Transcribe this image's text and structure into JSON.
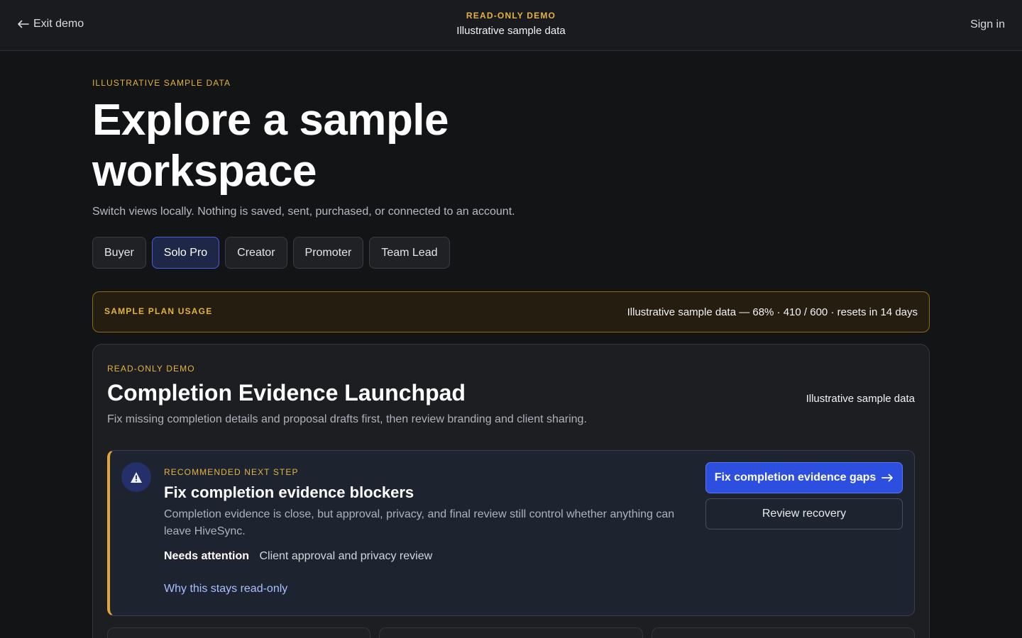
{
  "topbar": {
    "exit_label": "Exit demo",
    "eyebrow": "READ-ONLY DEMO",
    "subtitle": "Illustrative sample data",
    "signin_label": "Sign in"
  },
  "hero": {
    "eyebrow": "ILLUSTRATIVE SAMPLE DATA",
    "title": "Explore a sample workspace",
    "subtitle": "Switch views locally. Nothing is saved, sent, purchased, or connected to an account."
  },
  "tabs": [
    {
      "label": "Buyer",
      "active": false
    },
    {
      "label": "Solo Pro",
      "active": true
    },
    {
      "label": "Creator",
      "active": false
    },
    {
      "label": "Promoter",
      "active": false
    },
    {
      "label": "Team Lead",
      "active": false
    }
  ],
  "usage": {
    "label": "SAMPLE PLAN USAGE",
    "value": "Illustrative sample data — 68% · 410 / 600 · resets in 14 days"
  },
  "card": {
    "eyebrow": "READ-ONLY DEMO",
    "title": "Completion Evidence Launchpad",
    "description": "Fix missing completion details and proposal drafts first, then review branding and client sharing.",
    "right_label": "Illustrative sample data"
  },
  "recommendation": {
    "eyebrow": "RECOMMENDED NEXT STEP",
    "title": "Fix completion evidence blockers",
    "description": "Completion evidence is close, but approval, privacy, and final review still control whether anything can leave HiveSync.",
    "attention_label": "Needs attention",
    "attention_value": "Client approval and privacy review",
    "link_label": "Why this stays read-only",
    "primary_button": "Fix completion evidence gaps",
    "secondary_button": "Review recovery",
    "icon": "alert-triangle-icon"
  },
  "colors": {
    "accent_gold": "#e3b341",
    "primary_blue": "#2d4fe0",
    "background": "#131416"
  }
}
